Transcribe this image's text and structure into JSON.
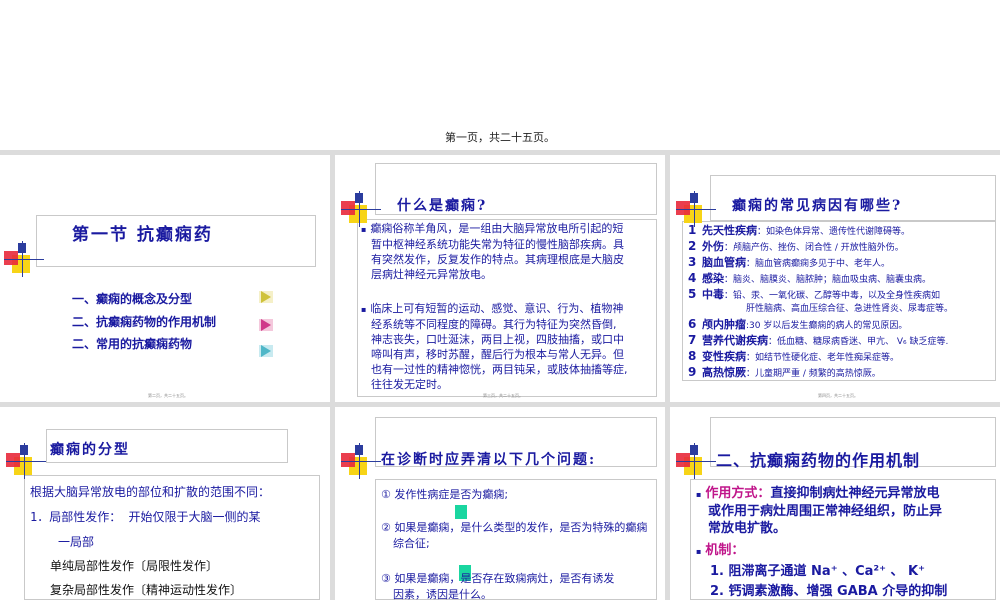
{
  "page_label": "第一页，共二十五页。",
  "slide1": {
    "title": "第一节  抗癫痫药",
    "menu": [
      "一、癫痫的概念及分型",
      "二、抗癫痫药物的作用机制",
      "二、常用的抗癫痫药物"
    ],
    "footer": "第二页，共二十五页。"
  },
  "slide2": {
    "title": "什么是癫痫?",
    "para1_lines": [
      "癫痫俗称羊角风，是一组由大脑异常放电所引起的短",
      "暂中枢神经系统功能失常为特征的慢性脑部疾病。具",
      "有突然发作，反复发作的特点。其病理根底是大脑皮",
      "层病灶神经元异常放电。"
    ],
    "para2_lines": [
      "临床上可有短暂的运动、感觉、意识、行为、植物神",
      "经系统等不同程度的障碍。其行为特征为突然昏倒,",
      "神志丧失，口吐涎沫，两目上视，四肢抽搐，或口中",
      "啼叫有声，移时苏醒，醒后行为根本与常人无异。但",
      "也有一过性的精神惚恍，两目钝呆，或肢体抽搐等症,",
      "往往发无定时。"
    ],
    "footer": "第三页，共二十五页。"
  },
  "slide3": {
    "title": "癫痫的常见病因有哪些?",
    "items": [
      {
        "num": "1",
        "head": "先天性疾病",
        "body": "：如染色体异常、遗传性代谢障碍等。"
      },
      {
        "num": "2",
        "head": "外伤",
        "body": "：颅脑产伤、挫伤、闭合性 / 开放性脑外伤。"
      },
      {
        "num": "3",
        "head": "脑血管病",
        "body": "：脑血管病癫痫多见于中、老年人。"
      },
      {
        "num": "4",
        "head": "感染",
        "body": "：脑炎、脑膜炎、脑脓肿；脑血吸虫病、脑囊虫病。"
      },
      {
        "num": "5",
        "head": "中毒",
        "body": "：铅、汞、一氧化碳、乙醇等中毒，以及全身性疾病如"
      },
      {
        "num": "",
        "head": "",
        "body": "肝性脑病、高血压综合征、急进性肾炎、尿毒症等。"
      },
      {
        "num": "6",
        "head": "颅内肿瘤",
        "body": ":30 岁以后发生癫痫的病人的常见原因。"
      },
      {
        "num": "7",
        "head": "营养代谢疾病",
        "body": "：低血糖、糖尿病昏迷、甲亢、 V₆ 缺乏症等."
      },
      {
        "num": "8",
        "head": "变性疾病",
        "body": "：如结节性硬化症、老年性痴呆症等。"
      },
      {
        "num": "9",
        "head": "高热惊厥",
        "body": "：儿童期严重 / 频繁的高热惊厥。"
      }
    ],
    "footer": "第四页，共二十五页。"
  },
  "slide4": {
    "title": "癫痫的分型",
    "lines": [
      "根据大脑异常放电的部位和扩散的范围不同：",
      "1．局部性发作： 开始仅限于大脑一侧的某",
      "一局部",
      "单纯局部性发作〔局限性发作〕",
      "复杂局部性发作〔精神运动性发作〕"
    ]
  },
  "slide5": {
    "title": "在诊断时应弄清以下几个问题:",
    "q1": "① 发作性病症是否为癫痫;",
    "q2_lines": [
      "② 如果是癫痫，是什么类型的发作，是否为特殊的癫痫",
      "综合征;"
    ],
    "q3_lines": [
      "③ 如果是癫痫，是否存在致痫病灶，是否有诱发",
      "因素，诱因是什么。"
    ]
  },
  "slide6": {
    "title": "二、抗癫痫药物的作用机制",
    "mode_label": "作用方式：",
    "mode_lines": [
      "直接抑制病灶神经元异常放电",
      "或作用于病灶周围正常神经组织，防止异",
      "常放电扩散。"
    ],
    "mech_label": "机制：",
    "mech_items": [
      "1. 阻滞离子通道  Na⁺ 、Ca²⁺ 、 K⁺",
      "2. 钙调素激酶、增强 GABA 介导的抑制"
    ]
  },
  "colors": {
    "blue": "#1a1aa0",
    "magenta": "#c0158a",
    "yellow": "#f7d417",
    "red": "#e8293b",
    "arrow_yellow": "#cfc23a",
    "arrow_pink": "#d03a8a",
    "arrow_cyan": "#4fb7c8",
    "teal_marker": "#1ad6a0"
  }
}
